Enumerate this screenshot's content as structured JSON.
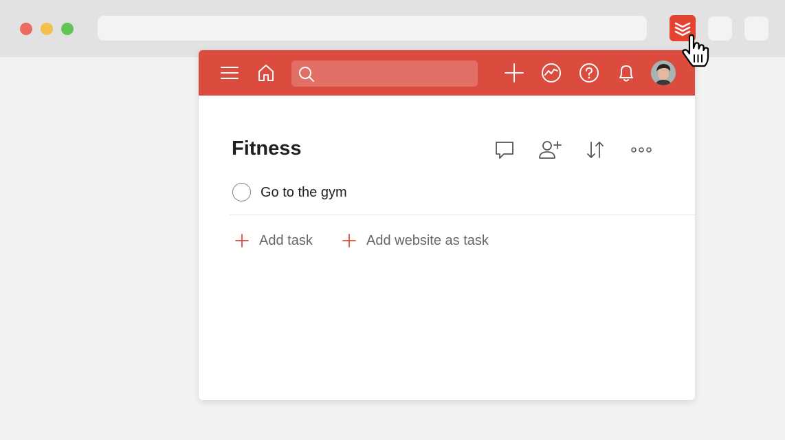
{
  "browser": {
    "url_value": "",
    "extension": {
      "name": "Todoist",
      "color": "#e44332"
    }
  },
  "popup": {
    "topbar_color": "#db4c3f",
    "search": {
      "value": "",
      "placeholder": ""
    },
    "icons": [
      "menu-icon",
      "home-icon",
      "search-icon",
      "add-icon",
      "productivity-icon",
      "help-icon",
      "notifications-icon",
      "avatar"
    ]
  },
  "project": {
    "title": "Fitness",
    "actions": [
      "comment-icon",
      "share-icon",
      "sort-icon",
      "more-icon"
    ]
  },
  "tasks": [
    {
      "content": "Go to the gym",
      "completed": false
    }
  ],
  "add_actions": {
    "add_task_label": "Add task",
    "add_website_label": "Add website as task",
    "accent": "#dd4b39"
  }
}
